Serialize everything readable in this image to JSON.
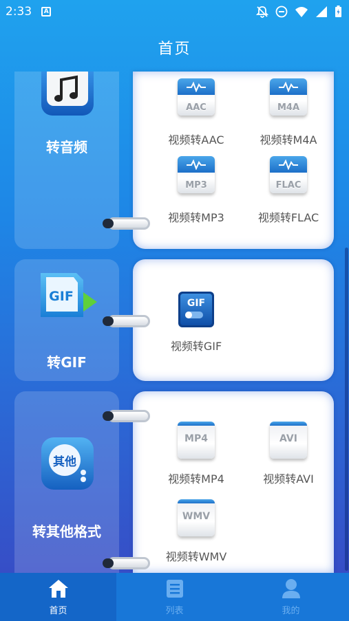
{
  "status": {
    "time": "2:33",
    "notif_badge": "A"
  },
  "header": {
    "title": "首页"
  },
  "categories": [
    {
      "label": "转音频",
      "items": [
        {
          "label": "视频转AAC",
          "code": "AAC"
        },
        {
          "label": "视频转M4A",
          "code": "M4A"
        },
        {
          "label": "视频转MP3",
          "code": "MP3"
        },
        {
          "label": "视频转FLAC",
          "code": "FLAC"
        }
      ]
    },
    {
      "label": "转GIF",
      "icon_text": "GIF",
      "items": [
        {
          "label": "视频转GIF",
          "code": "GIF"
        }
      ]
    },
    {
      "label": "转其他格式",
      "icon_text": "其他",
      "items": [
        {
          "label": "视频转MP4",
          "code": "MP4"
        },
        {
          "label": "视频转AVI",
          "code": "AVI"
        },
        {
          "label": "视频转WMV",
          "code": "WMV"
        }
      ]
    }
  ],
  "nav": [
    {
      "label": "首页",
      "icon": "home-icon",
      "active": true
    },
    {
      "label": "列表",
      "icon": "list-icon",
      "active": false
    },
    {
      "label": "我的",
      "icon": "profile-icon",
      "active": false
    }
  ],
  "colors": {
    "accent": "#1877d8",
    "icon_band": "#1c6fc8"
  }
}
